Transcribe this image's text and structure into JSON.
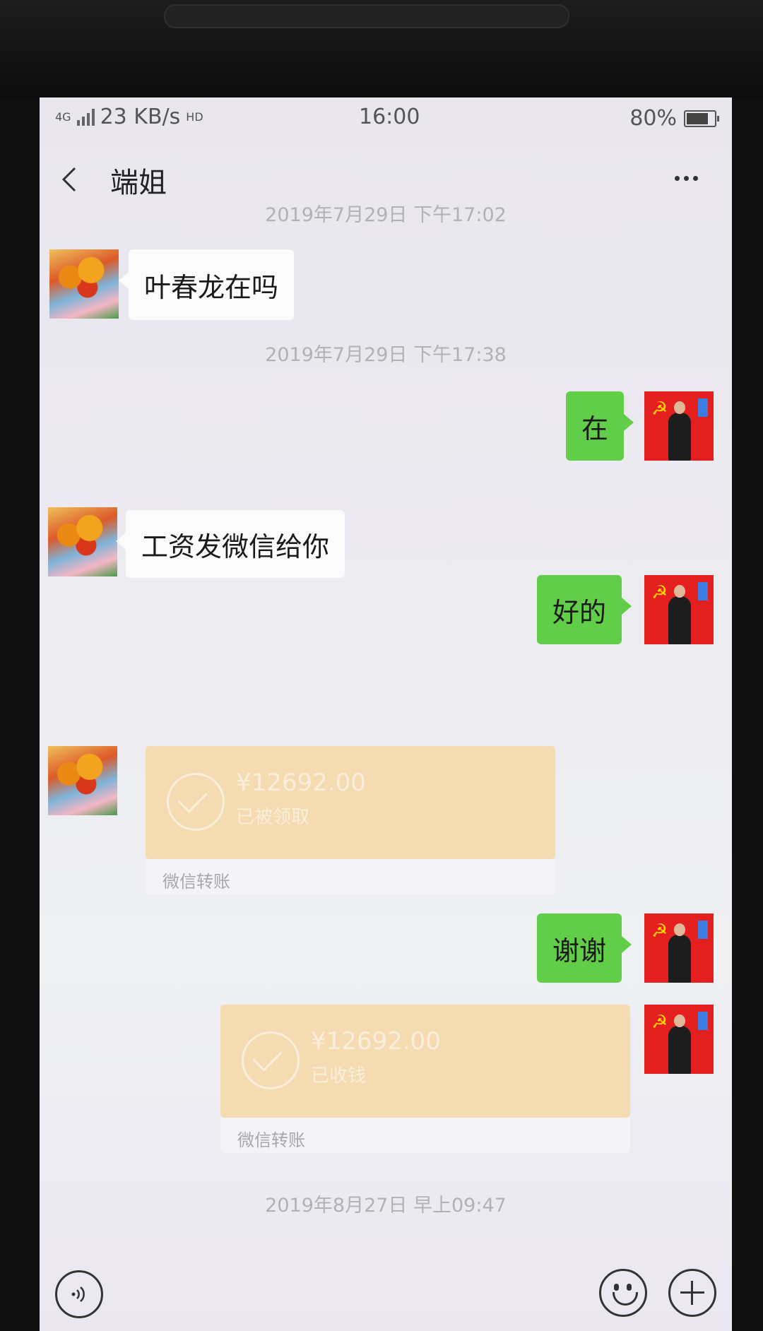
{
  "status_bar": {
    "network": "4G",
    "speed": "23 KB/s",
    "hd": "HD",
    "time": "16:00",
    "battery": "80%"
  },
  "header": {
    "title": "端姐"
  },
  "messages": {
    "ts1": "2019年7月29日 下午17:02",
    "m1": "叶春龙在吗",
    "ts2": "2019年7月29日 下午17:38",
    "m2": "在",
    "m3": "工资发微信给你",
    "m4": "好的",
    "t1_amount": "¥12692.00",
    "t1_status": "已被领取",
    "t1_label": "微信转账",
    "m5": "谢谢",
    "t2_amount": "¥12692.00",
    "t2_status": "已收钱",
    "t2_label": "微信转账",
    "ts3": "2019年8月27日 早上09:47"
  },
  "icons": {
    "back": "chevron-left-icon",
    "more": "ellipsis-icon",
    "voice": "voice-icon",
    "emoji": "emoji-icon",
    "add": "plus-icon"
  },
  "colors": {
    "outgoing_bubble": "#62cd48",
    "transfer_card": "#f4dbb2"
  }
}
